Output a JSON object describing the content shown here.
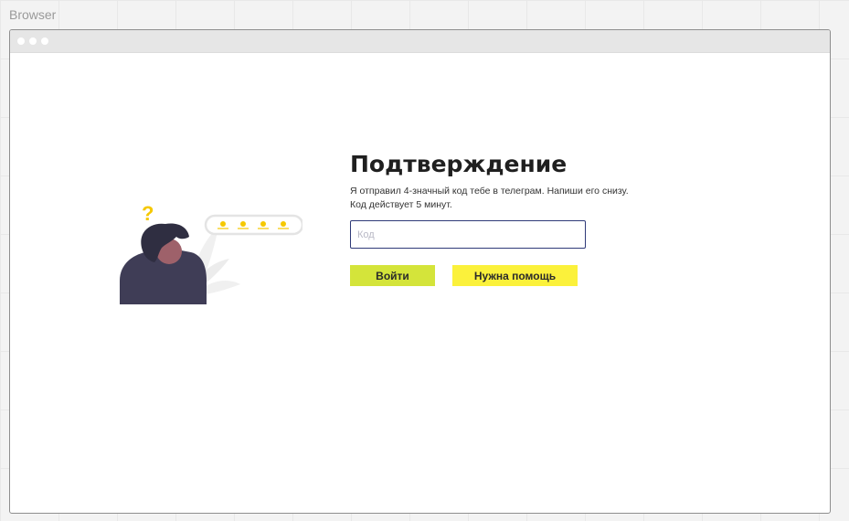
{
  "canvas": {
    "label": "Browser"
  },
  "page": {
    "title": "Подтверждение",
    "description_line1": "Я отправил 4-значный код тебе в телеграм. Напиши его снизу.",
    "description_line2": "Код действует 5 минут."
  },
  "form": {
    "code_placeholder": "Код",
    "code_value": ""
  },
  "buttons": {
    "login": "Войти",
    "help": "Нужна помощь"
  },
  "illustration": {
    "question_mark": "?",
    "code_dots_count": 4
  },
  "colors": {
    "accent_login": "#d4e43a",
    "accent_help": "#fbf13b",
    "input_border": "#2f3a78",
    "illustration_yellow": "#f5c800",
    "illustration_jacket": "#3f3d56"
  }
}
